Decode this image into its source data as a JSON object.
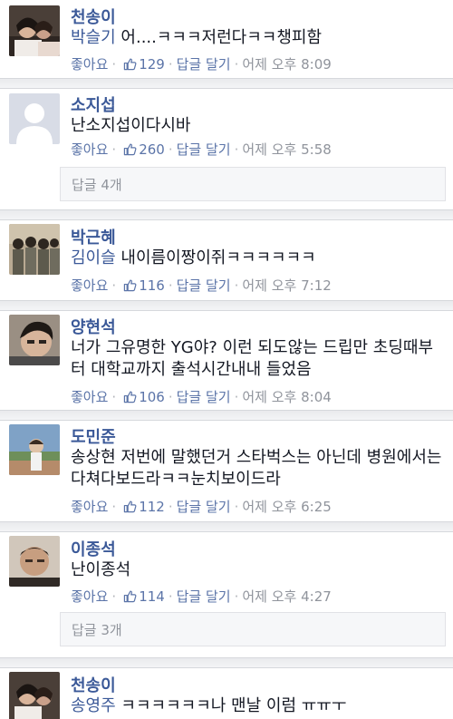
{
  "actions": {
    "like": "좋아요",
    "reply": "답글 달기",
    "sep": "·"
  },
  "colors": {
    "name": "#3b5998",
    "tag": "#3b5998",
    "meta": "#90949c",
    "divider": "#e9eaed"
  },
  "comments": [
    {
      "name": "천송이",
      "tag": "박슬기",
      "text": " 어....ㅋㅋㅋ저런다ㅋㅋ챙피함",
      "likes": "129",
      "time": "어제 오후 8:09",
      "avatar": "couple-photo"
    },
    {
      "name": "소지섭",
      "tag": "",
      "text": "난소지섭이다시바",
      "likes": "260",
      "time": "어제 오후 5:58",
      "replies": "답글 4개",
      "avatar": "default-silhouette"
    },
    {
      "name": "박근혜",
      "tag": "김이슬",
      "text": " 내이름이짱이쥐ㅋㅋㅋㅋㅋㅋ",
      "likes": "116",
      "time": "어제 오후 7:12",
      "avatar": "group-photo"
    },
    {
      "name": "양현석",
      "tag": "",
      "text": "너가 그유명한 YG야? 이런 되도않는 드립만 초딩때부터 대학교까지 출석시간내내 들었음",
      "likes": "106",
      "time": "어제 오후 8:04",
      "avatar": "boy-photo"
    },
    {
      "name": "도민준",
      "tag": "",
      "text": "송상현 저번에 말했던거 스타벅스는 아닌데 병원에서는 다쳐다보드라ㅋㅋ눈치보이드라",
      "likes": "112",
      "time": "어제 오후 6:25",
      "avatar": "outdoor-photo"
    },
    {
      "name": "이종석",
      "tag": "",
      "text": "난이종석",
      "likes": "114",
      "time": "어제 오후 4:27",
      "replies": "답글 3개",
      "avatar": "face-photo"
    },
    {
      "name": "천송이",
      "tag": "송영주",
      "text": " ㅋㅋㅋㅋㅋㅋ나 맨날 이럼 ㅠㅠㅜ",
      "likes": "",
      "time": "",
      "avatar": "couple-photo"
    }
  ]
}
